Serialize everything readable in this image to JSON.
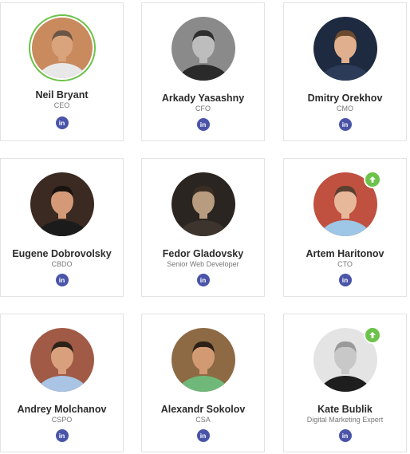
{
  "team": [
    {
      "name": "Neil Bryant",
      "role": "CEO",
      "social": "in",
      "highlighted": true,
      "badge": false,
      "photo": {
        "bg": "#c98a5e",
        "skin": "#d9a47c",
        "shirt": "#e8e8e8",
        "hair": "#6a5546",
        "gray": false
      }
    },
    {
      "name": "Arkady Yasashny",
      "role": "CFO",
      "social": "in",
      "highlighted": false,
      "badge": false,
      "photo": {
        "bg": "#8a8a8a",
        "skin": "#bdbdbd",
        "shirt": "#2a2a2a",
        "hair": "#2e2e2e",
        "gray": true
      }
    },
    {
      "name": "Dmitry Orekhov",
      "role": "CMO",
      "social": "in",
      "highlighted": false,
      "badge": false,
      "photo": {
        "bg": "#1d2a3f",
        "skin": "#e0b08e",
        "shirt": "#2c3b57",
        "hair": "#6b4a2f",
        "gray": false
      }
    },
    {
      "name": "Eugene Dobrovolsky",
      "role": "CBDO",
      "social": "in",
      "highlighted": false,
      "badge": false,
      "photo": {
        "bg": "#3a2a22",
        "skin": "#d49a78",
        "shirt": "#1b1b1b",
        "hair": "#1a1410",
        "gray": false
      }
    },
    {
      "name": "Fedor Gladovsky",
      "role": "Senior Web Developer",
      "social": "in",
      "highlighted": false,
      "badge": false,
      "photo": {
        "bg": "#2a2520",
        "skin": "#b89c80",
        "shirt": "#3d352d",
        "hair": "#3a2e24",
        "gray": false
      }
    },
    {
      "name": "Artem Haritonov",
      "role": "CTO",
      "social": "in",
      "highlighted": false,
      "badge": true,
      "photo": {
        "bg": "#c05040",
        "skin": "#e8b89a",
        "shirt": "#9ec6e6",
        "hair": "#5a4030",
        "gray": false
      }
    },
    {
      "name": "Andrey Molchanov",
      "role": "CSPO",
      "social": "in",
      "highlighted": false,
      "badge": false,
      "photo": {
        "bg": "#a05a45",
        "skin": "#d8a07c",
        "shirt": "#a9c4e4",
        "hair": "#2c2018",
        "gray": false
      }
    },
    {
      "name": "Alexandr Sokolov",
      "role": "CSA",
      "social": "in",
      "highlighted": false,
      "badge": false,
      "photo": {
        "bg": "#8d6a44",
        "skin": "#d29a72",
        "shirt": "#6fb87a",
        "hair": "#2c2018",
        "gray": false
      }
    },
    {
      "name": "Kate Bublik",
      "role": "Digital Marketing Expert",
      "social": "in",
      "highlighted": false,
      "badge": true,
      "photo": {
        "bg": "#e4e4e4",
        "skin": "#c8c8c8",
        "shirt": "#1e1e1e",
        "hair": "#9a9a9a",
        "gray": true
      }
    }
  ]
}
